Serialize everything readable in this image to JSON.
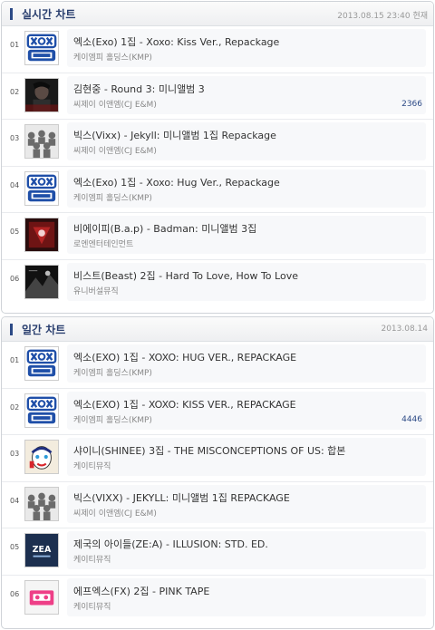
{
  "realtime": {
    "title": "실시간 차트",
    "date": "2013.08.15 23:40 현재",
    "items": [
      {
        "rank": "01",
        "title": "엑소(Exo) 1집 - Xoxo: Kiss Ver., Repackage",
        "artist": "케이엠피 홀딩스(KMP)",
        "count": "",
        "cover": "exo-cover"
      },
      {
        "rank": "02",
        "title": "김현중 - Round 3: 미니앨범 3",
        "artist": "씨제이 이앤엠(CJ E&M)",
        "count": "2366",
        "cover": "kimhyunjoong-cover"
      },
      {
        "rank": "03",
        "title": "빅스(Vixx) - Jekyll: 미니앨범 1집 Repackage",
        "artist": "씨제이 이앤엠(CJ E&M)",
        "count": "",
        "cover": "vixx-cover"
      },
      {
        "rank": "04",
        "title": "엑소(Exo) 1집 - Xoxo: Hug Ver., Repackage",
        "artist": "케이엠피 홀딩스(KMP)",
        "count": "",
        "cover": "exo-cover"
      },
      {
        "rank": "05",
        "title": "비에이피(B.a.p) - Badman: 미니앨범 3집",
        "artist": "로엔엔터테인먼트",
        "count": "",
        "cover": "bap-cover"
      },
      {
        "rank": "06",
        "title": "비스트(Beast) 2집 - Hard To Love, How To Love",
        "artist": "유니버설뮤직",
        "count": "",
        "cover": "beast-cover"
      }
    ]
  },
  "daily": {
    "title": "일간 차트",
    "date": "2013.08.14",
    "items": [
      {
        "rank": "01",
        "title": "엑소(EXO) 1집 - XOXO: HUG VER., REPACKAGE",
        "artist": "케이엠피 홀딩스(KMP)",
        "count": "",
        "cover": "exo-cover"
      },
      {
        "rank": "02",
        "title": "엑소(EXO) 1집 - XOXO: KISS VER., REPACKAGE",
        "artist": "케이엠피 홀딩스(KMP)",
        "count": "4446",
        "cover": "exo-cover"
      },
      {
        "rank": "03",
        "title": "샤이니(SHINEE) 3집 - THE MISCONCEPTIONS OF US: 합본",
        "artist": "케이티뮤직",
        "count": "",
        "cover": "shinee-cover"
      },
      {
        "rank": "04",
        "title": "빅스(VIXX) - JEKYLL: 미니앨범 1집 REPACKAGE",
        "artist": "씨제이 이앤엠(CJ E&M)",
        "count": "",
        "cover": "vixx-cover"
      },
      {
        "rank": "05",
        "title": "제국의 아이들(ZE:A) - ILLUSION: STD. ED.",
        "artist": "케이티뮤직",
        "count": "",
        "cover": "zea-cover"
      },
      {
        "rank": "06",
        "title": "에프엑스(FX) 2집 - PINK TAPE",
        "artist": "케이티뮤직",
        "count": "",
        "cover": "fx-cover"
      }
    ]
  }
}
